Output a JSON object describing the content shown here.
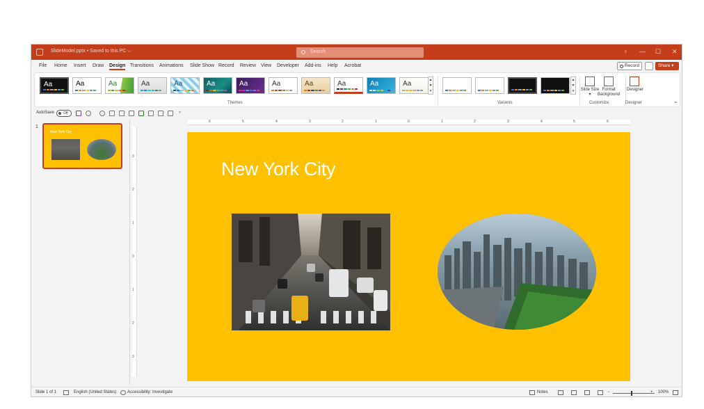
{
  "titlebar": {
    "doc_title": "SlideModel.pptx • Saved to this PC ⌵",
    "search_placeholder": "Search",
    "minimize": "—",
    "maximize": "☐",
    "close": "✕",
    "color": "#c43e1c"
  },
  "tabs": [
    "File",
    "Home",
    "Insert",
    "Draw",
    "Design",
    "Transitions",
    "Animations",
    "Slide Show",
    "Record",
    "Review",
    "View",
    "Developer",
    "Add-ins",
    "Help",
    "Acrobat"
  ],
  "active_tab": "Design",
  "actions": {
    "record": "Record",
    "share": "Share ▾"
  },
  "ribbon": {
    "themes_label": "Themes",
    "variants_label": "Variants",
    "customize_label": "Customize",
    "designer_label": "Designer",
    "theme_aa": "Aa",
    "slide_size": "Slide Size ▾",
    "format_background": "Format Background",
    "designer_button": "Designer",
    "collapse": "⌄"
  },
  "qat": {
    "autosave": "AutoSave",
    "toggle": "Off"
  },
  "thumbnails": [
    {
      "number": "1",
      "title": "New York City"
    }
  ],
  "hruler_ticks": [
    "6",
    "5",
    "4",
    "3",
    "2",
    "1",
    "0",
    "1",
    "2",
    "3",
    "4",
    "5",
    "6"
  ],
  "vruler_ticks": [
    "3",
    "2",
    "1",
    "0",
    "1",
    "2",
    "3"
  ],
  "slide": {
    "title": "New York City",
    "background": "#ffc000"
  },
  "statusbar": {
    "slide_count": "Slide 1 of 1",
    "language": "English (United States)",
    "accessibility": "Accessibility: Investigate",
    "notes": "Notes",
    "zoom": "100%"
  }
}
